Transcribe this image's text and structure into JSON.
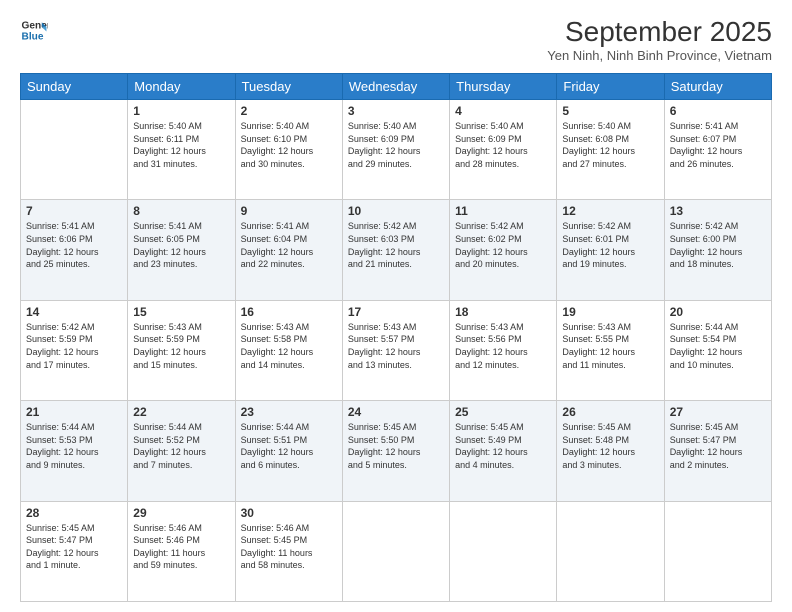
{
  "header": {
    "logo_line1": "General",
    "logo_line2": "Blue",
    "month_title": "September 2025",
    "location": "Yen Ninh, Ninh Binh Province, Vietnam"
  },
  "weekdays": [
    "Sunday",
    "Monday",
    "Tuesday",
    "Wednesday",
    "Thursday",
    "Friday",
    "Saturday"
  ],
  "weeks": [
    [
      {
        "day": "",
        "info": ""
      },
      {
        "day": "1",
        "info": "Sunrise: 5:40 AM\nSunset: 6:11 PM\nDaylight: 12 hours\nand 31 minutes."
      },
      {
        "day": "2",
        "info": "Sunrise: 5:40 AM\nSunset: 6:10 PM\nDaylight: 12 hours\nand 30 minutes."
      },
      {
        "day": "3",
        "info": "Sunrise: 5:40 AM\nSunset: 6:09 PM\nDaylight: 12 hours\nand 29 minutes."
      },
      {
        "day": "4",
        "info": "Sunrise: 5:40 AM\nSunset: 6:09 PM\nDaylight: 12 hours\nand 28 minutes."
      },
      {
        "day": "5",
        "info": "Sunrise: 5:40 AM\nSunset: 6:08 PM\nDaylight: 12 hours\nand 27 minutes."
      },
      {
        "day": "6",
        "info": "Sunrise: 5:41 AM\nSunset: 6:07 PM\nDaylight: 12 hours\nand 26 minutes."
      }
    ],
    [
      {
        "day": "7",
        "info": "Sunrise: 5:41 AM\nSunset: 6:06 PM\nDaylight: 12 hours\nand 25 minutes."
      },
      {
        "day": "8",
        "info": "Sunrise: 5:41 AM\nSunset: 6:05 PM\nDaylight: 12 hours\nand 23 minutes."
      },
      {
        "day": "9",
        "info": "Sunrise: 5:41 AM\nSunset: 6:04 PM\nDaylight: 12 hours\nand 22 minutes."
      },
      {
        "day": "10",
        "info": "Sunrise: 5:42 AM\nSunset: 6:03 PM\nDaylight: 12 hours\nand 21 minutes."
      },
      {
        "day": "11",
        "info": "Sunrise: 5:42 AM\nSunset: 6:02 PM\nDaylight: 12 hours\nand 20 minutes."
      },
      {
        "day": "12",
        "info": "Sunrise: 5:42 AM\nSunset: 6:01 PM\nDaylight: 12 hours\nand 19 minutes."
      },
      {
        "day": "13",
        "info": "Sunrise: 5:42 AM\nSunset: 6:00 PM\nDaylight: 12 hours\nand 18 minutes."
      }
    ],
    [
      {
        "day": "14",
        "info": "Sunrise: 5:42 AM\nSunset: 5:59 PM\nDaylight: 12 hours\nand 17 minutes."
      },
      {
        "day": "15",
        "info": "Sunrise: 5:43 AM\nSunset: 5:59 PM\nDaylight: 12 hours\nand 15 minutes."
      },
      {
        "day": "16",
        "info": "Sunrise: 5:43 AM\nSunset: 5:58 PM\nDaylight: 12 hours\nand 14 minutes."
      },
      {
        "day": "17",
        "info": "Sunrise: 5:43 AM\nSunset: 5:57 PM\nDaylight: 12 hours\nand 13 minutes."
      },
      {
        "day": "18",
        "info": "Sunrise: 5:43 AM\nSunset: 5:56 PM\nDaylight: 12 hours\nand 12 minutes."
      },
      {
        "day": "19",
        "info": "Sunrise: 5:43 AM\nSunset: 5:55 PM\nDaylight: 12 hours\nand 11 minutes."
      },
      {
        "day": "20",
        "info": "Sunrise: 5:44 AM\nSunset: 5:54 PM\nDaylight: 12 hours\nand 10 minutes."
      }
    ],
    [
      {
        "day": "21",
        "info": "Sunrise: 5:44 AM\nSunset: 5:53 PM\nDaylight: 12 hours\nand 9 minutes."
      },
      {
        "day": "22",
        "info": "Sunrise: 5:44 AM\nSunset: 5:52 PM\nDaylight: 12 hours\nand 7 minutes."
      },
      {
        "day": "23",
        "info": "Sunrise: 5:44 AM\nSunset: 5:51 PM\nDaylight: 12 hours\nand 6 minutes."
      },
      {
        "day": "24",
        "info": "Sunrise: 5:45 AM\nSunset: 5:50 PM\nDaylight: 12 hours\nand 5 minutes."
      },
      {
        "day": "25",
        "info": "Sunrise: 5:45 AM\nSunset: 5:49 PM\nDaylight: 12 hours\nand 4 minutes."
      },
      {
        "day": "26",
        "info": "Sunrise: 5:45 AM\nSunset: 5:48 PM\nDaylight: 12 hours\nand 3 minutes."
      },
      {
        "day": "27",
        "info": "Sunrise: 5:45 AM\nSunset: 5:47 PM\nDaylight: 12 hours\nand 2 minutes."
      }
    ],
    [
      {
        "day": "28",
        "info": "Sunrise: 5:45 AM\nSunset: 5:47 PM\nDaylight: 12 hours\nand 1 minute."
      },
      {
        "day": "29",
        "info": "Sunrise: 5:46 AM\nSunset: 5:46 PM\nDaylight: 11 hours\nand 59 minutes."
      },
      {
        "day": "30",
        "info": "Sunrise: 5:46 AM\nSunset: 5:45 PM\nDaylight: 11 hours\nand 58 minutes."
      },
      {
        "day": "",
        "info": ""
      },
      {
        "day": "",
        "info": ""
      },
      {
        "day": "",
        "info": ""
      },
      {
        "day": "",
        "info": ""
      }
    ]
  ]
}
